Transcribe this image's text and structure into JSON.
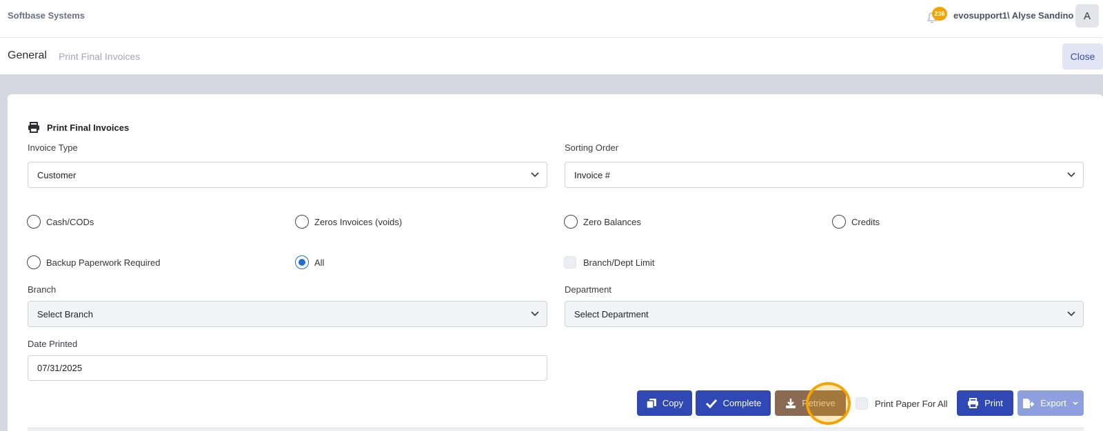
{
  "topbar": {
    "brand": "Softbase Systems",
    "notification_count": "236",
    "user": "evosupport1\\ Alyse Sandino",
    "avatar_initial": "A"
  },
  "subheader": {
    "title": "General",
    "breadcrumb": "Print Final Invoices",
    "close_label": "Close"
  },
  "form": {
    "section_title": "Print Final Invoices",
    "invoice_type": {
      "label": "Invoice Type",
      "value": "Customer"
    },
    "sorting_order": {
      "label": "Sorting Order",
      "value": "Invoice #"
    },
    "radios": [
      {
        "label": "Cash/CODs",
        "checked": false
      },
      {
        "label": "Zeros Invoices (voids)",
        "checked": false
      },
      {
        "label": "Zero Balances",
        "checked": false
      },
      {
        "label": "Credits",
        "checked": false
      },
      {
        "label": "Backup Paperwork Required",
        "checked": false
      },
      {
        "label": "All",
        "checked": true
      }
    ],
    "branch_dept_limit": {
      "label": "Branch/Dept Limit",
      "checked": false
    },
    "branch": {
      "label": "Branch",
      "placeholder": "Select Branch"
    },
    "department": {
      "label": "Department",
      "placeholder": "Select Department"
    },
    "date_printed": {
      "label": "Date Printed",
      "value": "07/31/2025"
    }
  },
  "actions": {
    "copy": "Copy",
    "complete": "Complete",
    "retrieve": "Retrieve",
    "print_paper_for_all": "Print Paper For All",
    "print": "Print",
    "export": "Export"
  },
  "colors": {
    "primary": "#2f48b3",
    "accent": "#f5a300",
    "band": "#d5d7e1"
  }
}
